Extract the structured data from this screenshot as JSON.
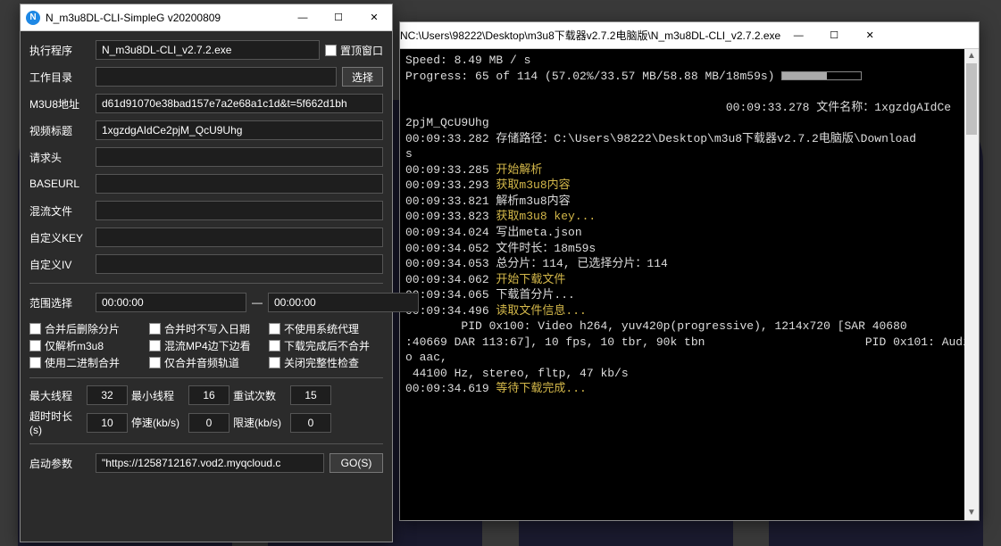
{
  "left": {
    "title": "N_m3u8DL-CLI-SimpleG v20200809",
    "labels": {
      "exec": "执行程序",
      "exec_val": "N_m3u8DL-CLI_v2.7.2.exe",
      "stay_top": "置顶窗口",
      "workdir": "工作目录",
      "choose": "选择",
      "m3u8addr": "M3U8地址",
      "m3u8_val": "d61d91070e38bad157e7a2e68a1c1d&t=5f662d1bh",
      "vtitle": "视频标题",
      "vtitle_val": "1xgzdgAIdCe2pjM_QcU9Uhg",
      "reqhead": "请求头",
      "baseurl": "BASEURL",
      "muxfile": "混流文件",
      "ckey": "自定义KEY",
      "civ": "自定义IV",
      "range": "范围选择",
      "t_from": "00:00:00",
      "dash": "—",
      "t_to": "00:00:00"
    },
    "checks": {
      "c1": "合并后删除分片",
      "c2": "合并时不写入日期",
      "c3": "不使用系统代理",
      "c4": "仅解析m3u8",
      "c5": "混流MP4边下边看",
      "c6": "下载完成后不合并",
      "c7": "使用二进制合并",
      "c8": "仅合并音频轨道",
      "c9": "关闭完整性检查"
    },
    "params": {
      "maxthread": "最大线程",
      "maxthread_v": "32",
      "minthread": "最小线程",
      "minthread_v": "16",
      "retry": "重试次数",
      "retry_v": "15",
      "timeout": "超时时长(s)",
      "timeout_v": "10",
      "stop": "停速(kb/s)",
      "stop_v": "0",
      "limit": "限速(kb/s)",
      "limit_v": "0",
      "startarg": "启动参数",
      "startarg_v": "\"https://1258712167.vod2.myqcloud.c",
      "go": "GO(S)"
    }
  },
  "right": {
    "title": "C:\\Users\\98222\\Desktop\\m3u8下载器v2.7.2电脑版\\N_m3u8DL-CLI_v2.7.2.exe",
    "speed_line": "Speed: 8.49 MB / s",
    "progress_line": "Progress: 65 of 114 (57.02%/33.57 MB/58.88 MB/18m59s) ",
    "filename_line": "                                              00:09:33.278 文件名称：1xgzdgAIdCe",
    "lines": [
      {
        "t": "2pjM_QcU9Uhg",
        "c": "w"
      },
      {
        "t": "00:09:33.282 存储路径：C:\\Users\\98222\\Desktop\\m3u8下载器v2.7.2电脑版\\Download",
        "c": "w"
      },
      {
        "t": "s",
        "c": "w"
      },
      {
        "t": "00:09:33.285 ",
        "msg": "开始解析",
        "c": "y"
      },
      {
        "t": "00:09:33.293 ",
        "msg": "获取m3u8内容",
        "c": "y"
      },
      {
        "t": "00:09:33.821 解析m3u8内容",
        "c": "w"
      },
      {
        "t": "00:09:33.823 ",
        "msg": "获取m3u8 key...",
        "c": "y"
      },
      {
        "t": "00:09:34.024 写出meta.json",
        "c": "w"
      },
      {
        "t": "00:09:34.052 文件时长：18m59s",
        "c": "w"
      },
      {
        "t": "00:09:34.053 总分片：114, 已选择分片：114",
        "c": "w"
      },
      {
        "t": "00:09:34.062 ",
        "msg": "开始下载文件",
        "c": "y"
      },
      {
        "t": "00:09:34.065 下载首分片...",
        "c": "w"
      },
      {
        "t": "00:09:34.496 ",
        "msg": "读取文件信息...",
        "c": "y"
      },
      {
        "t": "        PID 0x100: Video h264, yuv420p(progressive), 1214x720 [SAR 40680",
        "c": "w"
      },
      {
        "t": ":40669 DAR 113:67], 10 fps, 10 tbr, 90k tbn                       PID 0x101: Audio aac,",
        "c": "w"
      },
      {
        "t": " 44100 Hz, stereo, fltp, 47 kb/s",
        "c": "w"
      },
      {
        "t": "00:09:34.619 ",
        "msg": "等待下载完成...",
        "c": "y"
      }
    ]
  }
}
